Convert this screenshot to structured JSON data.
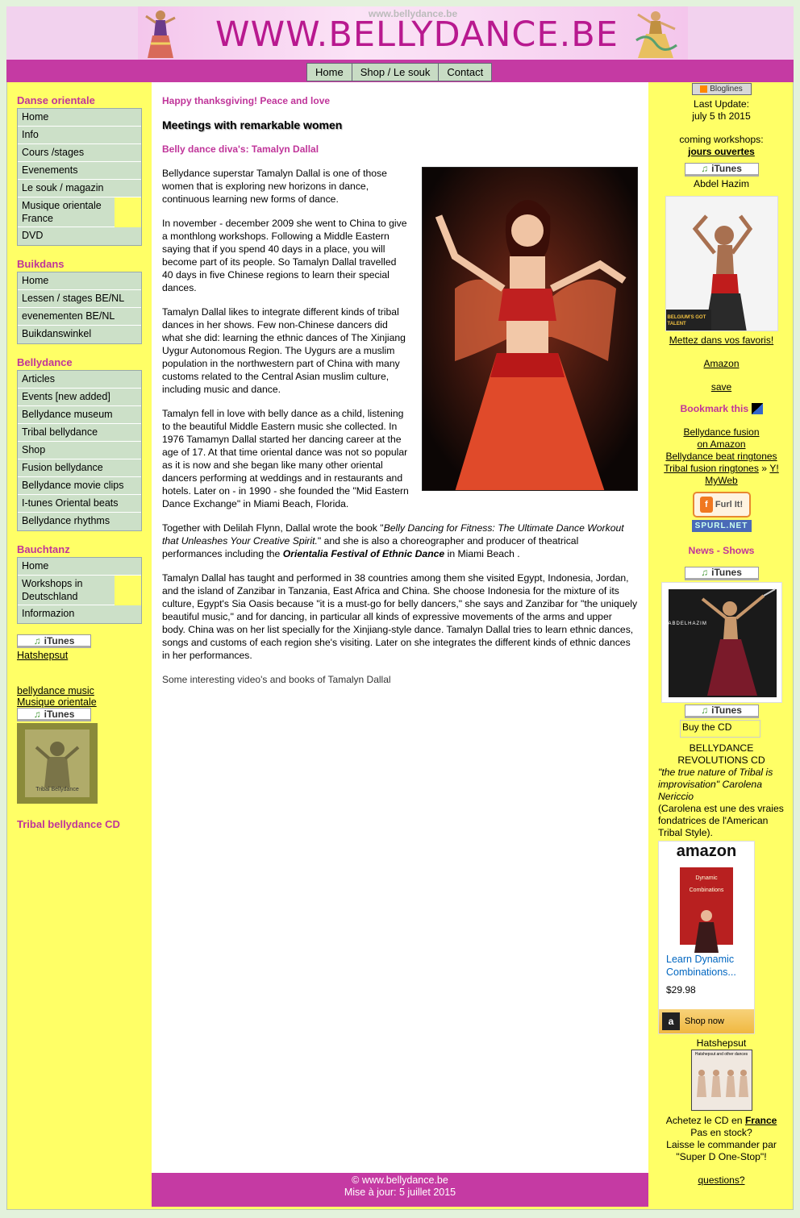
{
  "header": {
    "watermark": "www.bellydance.be",
    "site_title": "WWW.BELLYDANCE.BE"
  },
  "topnav": [
    {
      "label": "Home"
    },
    {
      "label": "Shop / Le souk"
    },
    {
      "label": "Contact"
    }
  ],
  "left": {
    "sections": [
      {
        "title": "Danse orientale",
        "items": [
          "Home",
          "Info",
          "Cours /stages",
          "Evenements",
          "Le souk / magazin",
          "Musique orientale France",
          "DVD"
        ]
      },
      {
        "title": "Buikdans",
        "items": [
          "Home",
          "Lessen / stages BE/NL",
          "evenementen BE/NL",
          "Buikdanswinkel"
        ]
      },
      {
        "title": "Bellydance",
        "items": [
          "Articles",
          "Events [new added]",
          "Bellydance museum",
          "Tribal bellydance",
          "Shop",
          "Fusion bellydance",
          "Bellydance movie clips",
          "I-tunes Oriental beats",
          "Bellydance rhythms"
        ]
      },
      {
        "title": "Bauchtanz",
        "items": [
          "Home",
          "Workshops in Deutschland",
          "Informazion"
        ]
      }
    ],
    "itunes_label": "iTunes",
    "hatshepsut_link": "Hatshepsut",
    "music_link": "bellydance music",
    "musique_link": "Musique orientale",
    "cd_title": "Tribal bellydance CD",
    "cd_caption": "Tribal Bellydance"
  },
  "main": {
    "greeting": "Happy thanksgiving! Peace and love",
    "headline": "Meetings with remarkable women",
    "subhead": "Belly dance diva's: Tamalyn Dallal",
    "p1": "Bellydance superstar Tamalyn Dallal is one of those women that is exploring new horizons in dance, continuous learning new forms of dance.",
    "p2": "In november - december 2009 she went to China to give a monthlong workshops. Following a Middle Eastern saying that if you spend 40 days in a place, you will become part of its people. So Tamalyn Dallal travelled 40 days in five Chinese regions to learn their special dances.",
    "p3": "Tamalyn Dallal likes to integrate different kinds of tribal dances in her shows. Few non-Chinese dancers did what she did: learning the ethnic dances of The Xinjiang Uygur Autonomous Region. The Uygurs are a muslim population in the northwestern part of China with many customs related to the Central Asian muslim culture, including music and dance.",
    "p4": "Tamalyn fell in love with belly dance as a child, listening to the beautiful Middle Eastern music she collected. In 1976 Tamamyn Dallal started her dancing career at the age of 17. At that time oriental dance was not so popular as it is now and she began like many other oriental dancers performing at weddings and in restaurants and hotels. Later on - in 1990 - she founded the \"Mid Eastern Dance Exchange\" in Miami Beach, Florida.",
    "p5_a": "Together with Delilah Flynn, Dallal wrote the book \"",
    "p5_book": "Belly Dancing for Fitness: The Ultimate Dance Workout that Unleashes Your Creative Spirit.",
    "p5_b": "\" and she is also a choreographer and producer of theatrical performances including the ",
    "p5_festival": "Orientalia Festival of Ethnic Dance",
    "p5_c": " in Miami Beach .",
    "p6": "Tamalyn Dallal has taught and performed in 38 countries among them she visited Egypt, Indonesia, Jordan, and the island of Zanzibar in Tanzania, East Africa and China. She choose Indonesia for the mixture of its culture, Egypt's Sia Oasis because \"it is a must-go for belly dancers,\" she says and Zanzibar for \"the uniquely beautiful music,\" and for dancing, in particular all kinds of expressive movements of the arms and upper body. China was on her list specially for the Xinjiang-style dance. Tamalyn Dallal tries to learn ethnic dances, songs and customs of each region she's visiting. Later on she integrates the different kinds of ethnic dances in her performances.",
    "p7": "Some interesting video's and books of Tamalyn Dallal"
  },
  "footer": {
    "copyright": "© www.bellydance.be",
    "updated": "Mise à jour: 5 juillet 2015"
  },
  "right": {
    "bloglines": "Bloglines",
    "last_update_label": "Last Update:",
    "last_update_date": "july 5 th 2015",
    "workshops_label": "coming workshops:",
    "workshops_link": "jours ouvertes",
    "itunes_label": "iTunes",
    "artist": "Abdel Hazim",
    "talent_caption": "BELGIUM'S GOT TALENT",
    "favorites_link": "Mettez dans vos favoris!",
    "amazon_link": "Amazon",
    "save_link": "save",
    "bookmark": "Bookmark this",
    "fusion_link_1": "Bellydance fusion",
    "fusion_link_2": "on Amazon",
    "beat_link": "Bellydance beat ringtones",
    "tribal_link": "Tribal fusion ringtones",
    "sep": " » ",
    "yahoo_1": "Y!",
    "yahoo_2": "MyWeb",
    "furl": "Furl It!",
    "spurl": "SPURL.NET",
    "news_title": "News - Shows",
    "poster_text": "ABDELHAZIM",
    "buy_cd": "Buy the CD",
    "cd_name_1": "BELLYDANCE",
    "cd_name_2": "REVOLUTIONS CD",
    "quote": "\"the true nature of Tribal is improvisation\" Carolena Nericcio",
    "note": "(Carolena est une des vraies fondatrices de l'American Tribal Style).",
    "amazon_logo": "amazon",
    "book_title": "Dynamic Combinations",
    "product_link": "Learn Dynamic Combinations...",
    "price": "$29.98",
    "shop_now": "Shop now",
    "hatshepsut": "Hatshepsut",
    "cd_cover_text": "Hatshepsut and other dances",
    "buy_line_a": "Achetez le CD en ",
    "buy_line_link": "France",
    "stock": "Pas en stock?",
    "order_1": "Laisse le commander par",
    "order_2": "\"Super D One-Stop\"!",
    "questions": "questions?"
  }
}
